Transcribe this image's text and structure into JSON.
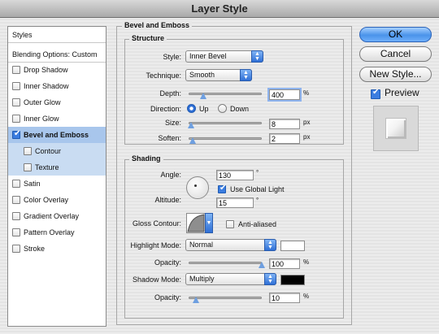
{
  "window": {
    "title": "Layer Style"
  },
  "styles_list": {
    "items": [
      {
        "label": "Styles",
        "checkbox": false
      },
      {
        "label": "Blending Options: Custom",
        "checkbox": false
      },
      {
        "label": "Drop Shadow",
        "checkbox": true,
        "checked": false
      },
      {
        "label": "Inner Shadow",
        "checkbox": true,
        "checked": false
      },
      {
        "label": "Outer Glow",
        "checkbox": true,
        "checked": false
      },
      {
        "label": "Inner Glow",
        "checkbox": true,
        "checked": false
      },
      {
        "label": "Bevel and Emboss",
        "checkbox": true,
        "checked": true,
        "selected": true
      },
      {
        "label": "Contour",
        "checkbox": true,
        "checked": false,
        "sub": true
      },
      {
        "label": "Texture",
        "checkbox": true,
        "checked": false,
        "sub": true
      },
      {
        "label": "Satin",
        "checkbox": true,
        "checked": false
      },
      {
        "label": "Color Overlay",
        "checkbox": true,
        "checked": false
      },
      {
        "label": "Gradient Overlay",
        "checkbox": true,
        "checked": false
      },
      {
        "label": "Pattern Overlay",
        "checkbox": true,
        "checked": false
      },
      {
        "label": "Stroke",
        "checkbox": true,
        "checked": false
      }
    ]
  },
  "bevel": {
    "title": "Bevel and Emboss",
    "structure": {
      "title": "Structure",
      "style_label": "Style:",
      "style_value": "Inner Bevel",
      "technique_label": "Technique:",
      "technique_value": "Smooth",
      "depth_label": "Depth:",
      "depth_value": "400",
      "depth_unit": "%",
      "depth_level": 0.2,
      "direction_label": "Direction:",
      "dir_up": "Up",
      "dir_down": "Down",
      "direction_selected": "Up",
      "size_label": "Size:",
      "size_value": "8",
      "size_unit": "px",
      "size_level": 0.03,
      "soften_label": "Soften:",
      "soften_value": "2",
      "soften_unit": "px",
      "soften_level": 0.06
    },
    "shading": {
      "title": "Shading",
      "angle_label": "Angle:",
      "angle_value": "130",
      "angle_unit": "°",
      "global_light_label": "Use Global Light",
      "global_light_checked": true,
      "altitude_label": "Altitude:",
      "altitude_value": "15",
      "altitude_unit": "°",
      "gloss_label": "Gloss Contour:",
      "anti_aliased_label": "Anti-aliased",
      "anti_aliased_checked": false,
      "highlight_mode_label": "Highlight Mode:",
      "highlight_mode_value": "Normal",
      "highlight_color": "#ffffff",
      "highlight_opacity_label": "Opacity:",
      "highlight_opacity_value": "100",
      "highlight_opacity_unit": "%",
      "highlight_opacity_level": 1.0,
      "shadow_mode_label": "Shadow Mode:",
      "shadow_mode_value": "Multiply",
      "shadow_color": "#000000",
      "shadow_opacity_label": "Opacity:",
      "shadow_opacity_value": "10",
      "shadow_opacity_unit": "%",
      "shadow_opacity_level": 0.1
    }
  },
  "buttons": {
    "ok": "OK",
    "cancel": "Cancel",
    "new_style": "New Style...",
    "preview": "Preview",
    "preview_checked": true
  },
  "colors": {
    "accent": "#3b7de0",
    "selection": "#a8c6ec"
  }
}
